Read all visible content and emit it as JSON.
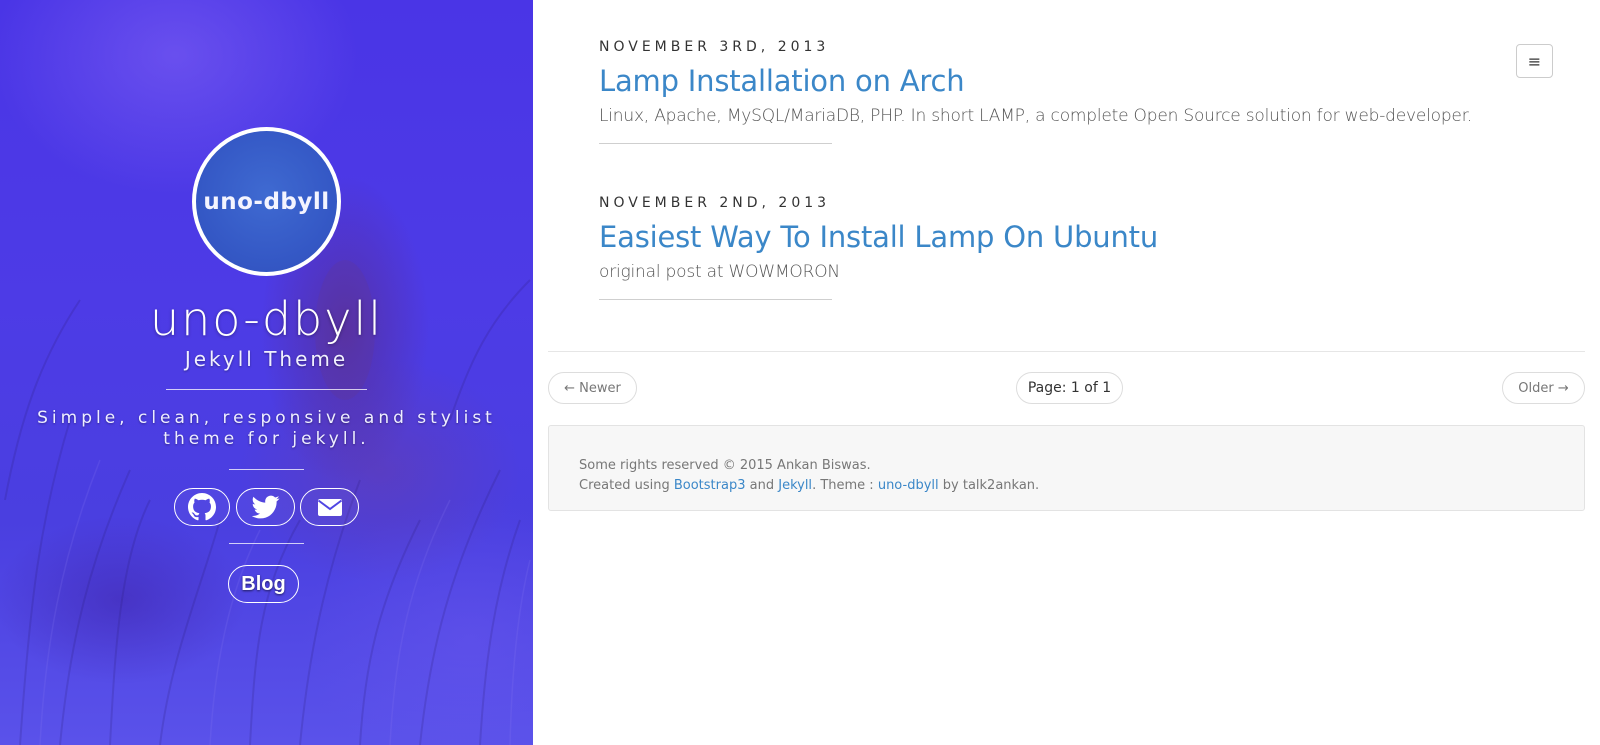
{
  "sidebar": {
    "avatar_text": "uno-dbyll",
    "title": "uno-dbyll",
    "subtitle": "Jekyll Theme",
    "description": "Simple, clean, responsive and stylist theme for jekyll.",
    "social": [
      {
        "icon": "github-icon"
      },
      {
        "icon": "twitter-icon"
      },
      {
        "icon": "envelope-icon"
      }
    ],
    "nav": [
      {
        "label": "Blog"
      }
    ],
    "colors": {
      "background": "#4a3fe0",
      "avatar_fill": "#3559c6",
      "text": "#ffffff"
    }
  },
  "header": {
    "menu_icon": "hamburger-icon",
    "menu_glyph": "≡"
  },
  "posts": [
    {
      "date": "NOVEMBER 3RD, 2013",
      "title": "Lamp Installation on Arch",
      "excerpt": "Linux, Apache, MySQL/MariaDB, PHP. In short LAMP, a complete Open Source solution for web-developer."
    },
    {
      "date": "NOVEMBER 2ND, 2013",
      "title": "Easiest Way To Install Lamp On Ubuntu",
      "excerpt": "original post at WOWMORON"
    }
  ],
  "pagination": {
    "newer": "← Newer",
    "page": "Page: 1 of 1",
    "older": "Older →"
  },
  "footer": {
    "rights": "Some rights reserved © 2015 Ankan Biswas.",
    "created_using": "Created using",
    "bootstrap_link": "Bootstrap3",
    "and": "and",
    "jekyll_link": "Jekyll",
    "theme_label": ". Theme :",
    "theme_link": "uno-dbyll",
    "by": "by talk2ankan."
  },
  "colors": {
    "link": "#3b87c8",
    "text": "#333333",
    "muted": "#777777",
    "footer_bg": "#f7f7f7"
  }
}
